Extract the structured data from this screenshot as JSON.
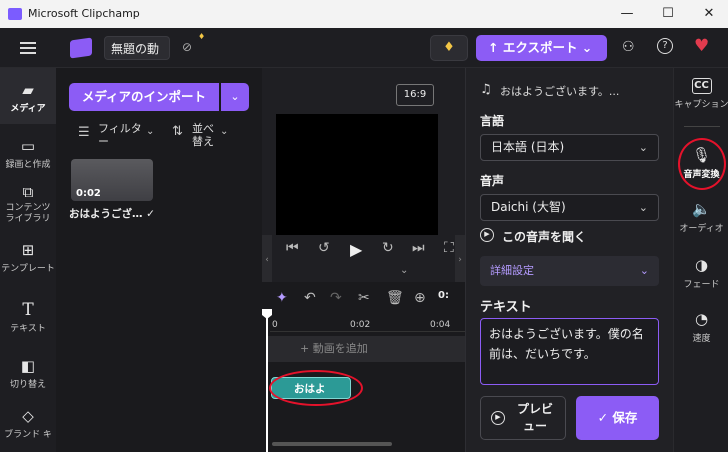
{
  "window": {
    "title": "Microsoft Clipchamp",
    "minimize": "—",
    "maximize": "☐",
    "close": "✕"
  },
  "appbar": {
    "project_name": "無題の動",
    "export_label": "↑ エクスポート ⌄",
    "gem_icon": "♦",
    "premium_badge": "♦"
  },
  "leftnav": {
    "items": [
      {
        "label": "メディア",
        "icon": "folder-icon"
      },
      {
        "label": "録画と作成",
        "icon": "camera-icon"
      },
      {
        "label": "コンテンツ ライブラリ",
        "icon": "library-icon"
      },
      {
        "label": "テンプレート",
        "icon": "template-icon"
      },
      {
        "label": "テキスト",
        "icon": "text-icon"
      },
      {
        "label": "切り替え",
        "icon": "transition-icon"
      },
      {
        "label": "ブランド キ",
        "icon": "brand-icon"
      }
    ]
  },
  "media": {
    "import_label": "メディアのインポート",
    "filter_label": "フィルター",
    "sort_label": "並べ替え",
    "thumb_duration": "0:02",
    "thumb_label": "おはようござ… ✓"
  },
  "preview": {
    "ratio": "16:9"
  },
  "timeline": {
    "ruler": [
      "0",
      "0:02",
      "0:04"
    ],
    "time_short": "0:",
    "video_placeholder": "+ 動画を追加",
    "clip_label": "おはよ"
  },
  "props": {
    "title": "おはようございます。...",
    "language_heading": "言語",
    "language_value": "日本語 (日本)",
    "voice_heading": "音声",
    "voice_value": "Daichi (大智)",
    "listen_label": "この音声を聞く",
    "advanced_label": "詳細設定",
    "text_heading": "テキスト",
    "text_value": "おはようございます。僕の名前は、だいちです。",
    "preview_label": "プレビュー",
    "save_label": "保存"
  },
  "rightnav": {
    "items": [
      {
        "label": "キャプション",
        "icon": "captions-icon",
        "glyph": "CC"
      },
      {
        "label": "音声変換",
        "icon": "microphone-icon",
        "glyph": "🎙"
      },
      {
        "label": "オーディオ",
        "icon": "speaker-icon",
        "glyph": "🔈"
      },
      {
        "label": "フェード",
        "icon": "fade-icon",
        "glyph": "◑"
      },
      {
        "label": "速度",
        "icon": "speed-icon",
        "glyph": "◔"
      }
    ]
  },
  "colors": {
    "accent": "#8c5cf5",
    "highlight": "#e5122b",
    "clip": "#2c9a96"
  }
}
